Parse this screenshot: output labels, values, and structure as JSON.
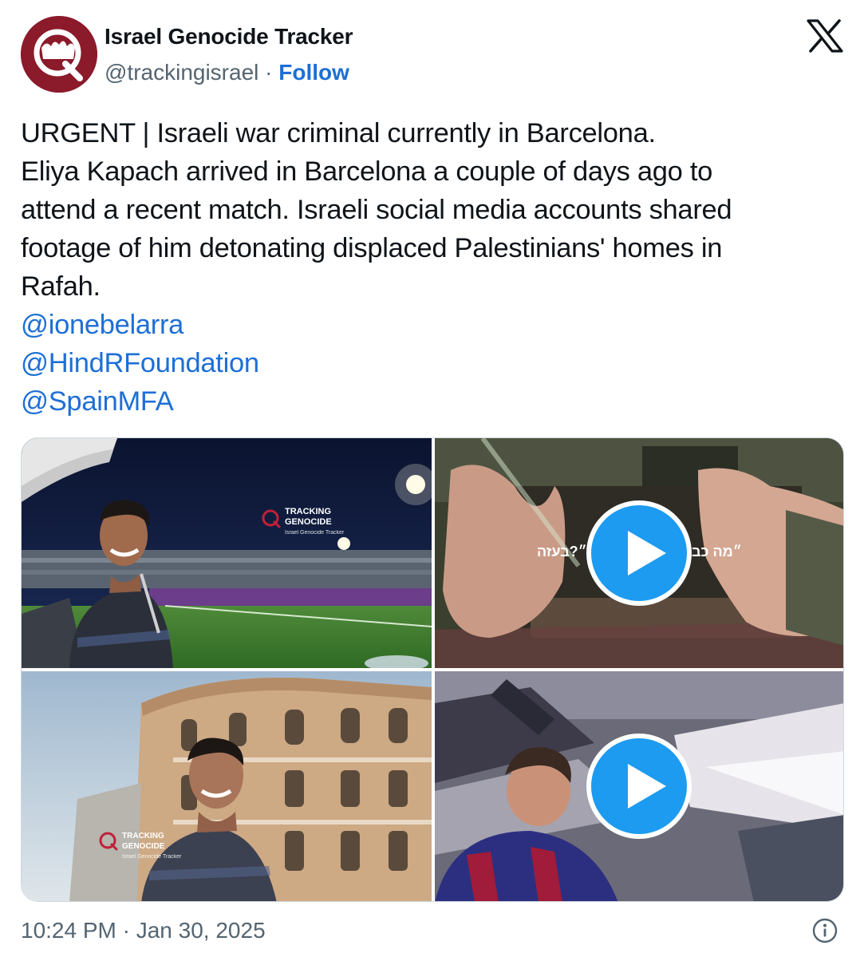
{
  "author": {
    "name": "Israel Genocide Tracker",
    "handle": "@trackingisrael",
    "separator": " · ",
    "follow_label": "Follow",
    "avatar_icon": "tracker-logo-avatar"
  },
  "platform_icon": "x-logo-icon",
  "tweet": {
    "lines": [
      "URGENT | Israeli war criminal currently in Barcelona.",
      "Eliya Kapach arrived in Barcelona a couple of days ago to",
      "attend a recent match. Israeli social media accounts shared",
      "footage of him detonating displaced Palestinians' homes in",
      "Rafah."
    ],
    "mentions": [
      "@ionebelarra",
      "@HindRFoundation",
      "@SpainMFA"
    ]
  },
  "media": {
    "tiles": [
      {
        "type": "photo",
        "watermark_title": "TRACKING\nGENOCIDE",
        "watermark_sub": "Israel Genocide Tracker"
      },
      {
        "type": "video",
        "caption_left": "״?בעזה",
        "caption_right": "״מה כב"
      },
      {
        "type": "photo",
        "watermark_title": "TRACKING\nGENOCIDE",
        "watermark_sub": "Israel Genocide Tracker"
      },
      {
        "type": "video"
      }
    ]
  },
  "footer": {
    "timestamp": "10:24 PM · Jan 30, 2025",
    "info_icon": "info-icon"
  },
  "colors": {
    "link": "#1d6fd6",
    "secondary_text": "#536471",
    "play_button": "#1d9bf0",
    "avatar_bg": "#8b1a2b"
  }
}
